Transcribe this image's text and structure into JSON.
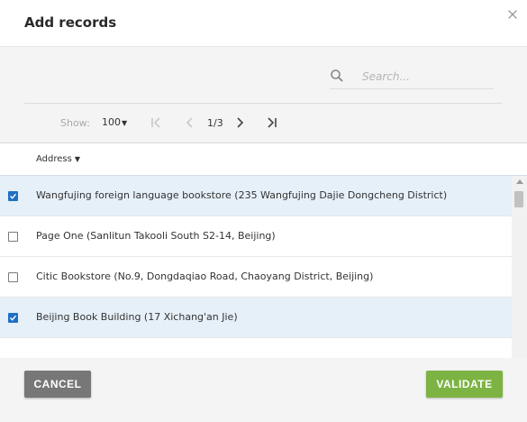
{
  "dialog": {
    "title": "Add records"
  },
  "toolbar": {
    "search": {
      "placeholder": "Search..."
    },
    "pager": {
      "show_label": "Show:",
      "show_value": "100",
      "page_indicator": "1/3"
    }
  },
  "table": {
    "column_header": "Address",
    "rows": [
      {
        "text": "Wangfujing foreign language bookstore (235 Wangfujing Dajie Dongcheng District)",
        "selected": true
      },
      {
        "text": "Page One (Sanlitun Takooli South S2-14, Beijing)",
        "selected": false
      },
      {
        "text": "Citic Bookstore (No.9, Dongdaqiao Road, Chaoyang District, Beijing)",
        "selected": false
      },
      {
        "text": "Beijing Book Building (17 Xichang'an Jie)",
        "selected": true
      },
      {
        "text": "",
        "selected": false
      }
    ]
  },
  "footer": {
    "cancel_label": "CANCEL",
    "validate_label": "VALIDATE"
  },
  "colors": {
    "selected_row": "#e6f0f8",
    "checkbox_checked": "#1f6fc5",
    "validate_button": "#7cb342",
    "cancel_button": "#777777"
  },
  "icons": {
    "close": "close-icon",
    "search": "search-icon",
    "first_page": "first-page-icon",
    "prev_page": "prev-page-icon",
    "next_page": "next-page-icon",
    "last_page": "last-page-icon",
    "sort": "sort-caret-icon"
  }
}
